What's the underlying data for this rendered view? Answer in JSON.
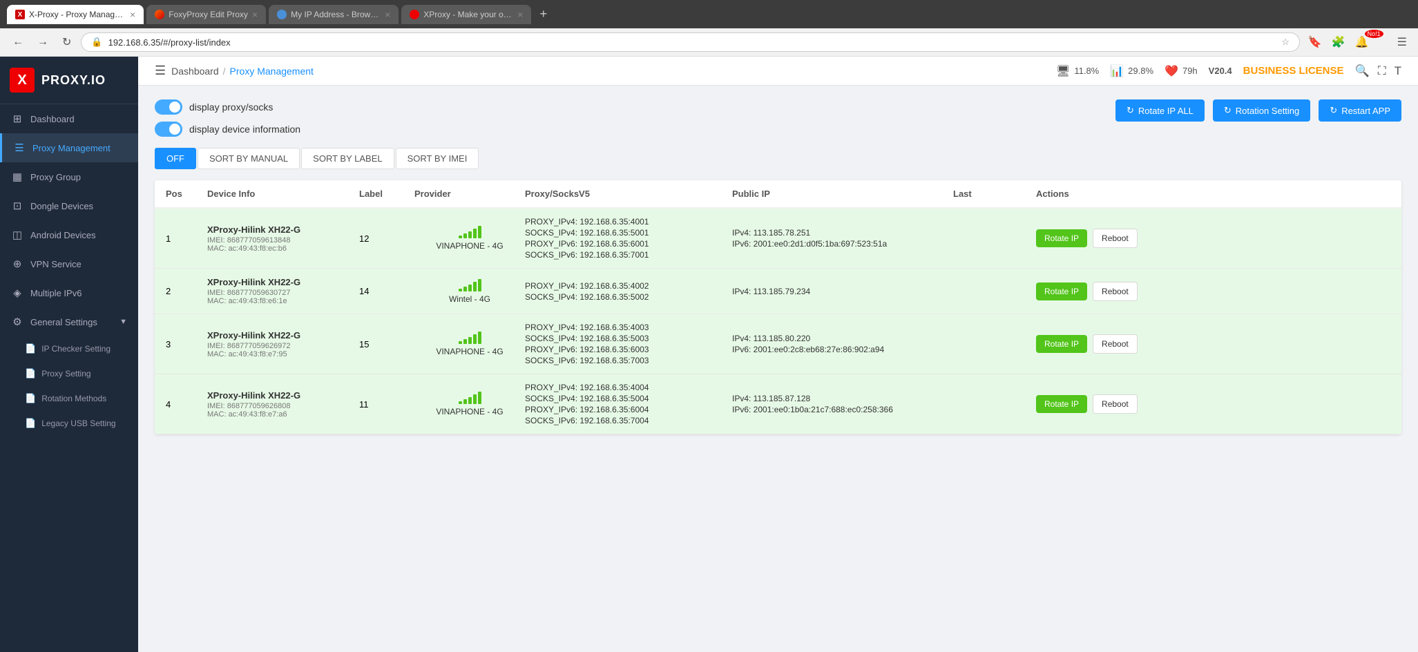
{
  "browser": {
    "tabs": [
      {
        "id": 1,
        "label": "X-Proxy - Proxy Managemen...",
        "favicon_type": "xproxy",
        "active": true
      },
      {
        "id": 2,
        "label": "FoxyProxy Edit Proxy",
        "favicon_type": "fox",
        "active": false
      },
      {
        "id": 3,
        "label": "My IP Address - Browser t...",
        "favicon_type": "browser",
        "active": false
      },
      {
        "id": 4,
        "label": "XProxy - Make your own...",
        "favicon_type": "xproxy-red",
        "active": false
      }
    ],
    "address": "192.168.6.35/#/proxy-list/index"
  },
  "topbar": {
    "breadcrumb_home": "Dashboard",
    "breadcrumb_sep": "/",
    "breadcrumb_current": "Proxy Management",
    "cpu_label": "11.8%",
    "ram_label": "29.8%",
    "uptime_label": "79h",
    "version": "V20.4",
    "license": "BUSINESS LICENSE"
  },
  "toolbar": {
    "toggle1_label": "display proxy/socks",
    "toggle2_label": "display device information",
    "rotate_all_label": "Rotate IP ALL",
    "rotation_setting_label": "Rotation Setting",
    "restart_app_label": "Restart APP"
  },
  "sort_tabs": [
    {
      "id": "off",
      "label": "OFF",
      "active": true
    },
    {
      "id": "manual",
      "label": "SORT BY MANUAL",
      "active": false
    },
    {
      "id": "label",
      "label": "SORT BY LABEL",
      "active": false
    },
    {
      "id": "imei",
      "label": "SORT BY IMEI",
      "active": false
    }
  ],
  "table": {
    "headers": [
      "Pos",
      "Device Info",
      "Label",
      "Provider",
      "Proxy/SocksV5",
      "Public IP",
      "Last",
      "Actions"
    ],
    "rows": [
      {
        "pos": "1",
        "device_name": "XProxy-Hilink XH22-G",
        "imei": "IMEI: 868777059613848",
        "mac": "MAC: ac:49:43:f8:ec:b6",
        "label": "12",
        "provider": "VINAPHONE - 4G",
        "proxy_lines": [
          "PROXY_IPv4: 192.168.6.35:4001",
          "SOCKS_IPv4: 192.168.6.35:5001",
          "PROXY_IPv6: 192.168.6.35:6001",
          "SOCKS_IPv6: 192.168.6.35:7001"
        ],
        "ipv4": "IPv4: 113.185.78.251",
        "ipv6": "IPv6: 2001:ee0:2d1:d0f5:1ba:697:523:51a",
        "rotate_label": "Rotate IP",
        "reboot_label": "Reboot",
        "green": true
      },
      {
        "pos": "2",
        "device_name": "XProxy-Hilink XH22-G",
        "imei": "IMEI: 868777059630727",
        "mac": "MAC: ac:49:43:f8:e6:1e",
        "label": "14",
        "provider": "Wintel - 4G",
        "proxy_lines": [
          "PROXY_IPv4: 192.168.6.35:4002",
          "SOCKS_IPv4: 192.168.6.35:5002"
        ],
        "ipv4": "IPv4: 113.185.79.234",
        "ipv6": "",
        "rotate_label": "Rotate IP",
        "reboot_label": "Reboot",
        "green": true
      },
      {
        "pos": "3",
        "device_name": "XProxy-Hilink XH22-G",
        "imei": "IMEI: 868777059626972",
        "mac": "MAC: ac:49:43:f8:e7:95",
        "label": "15",
        "provider": "VINAPHONE - 4G",
        "proxy_lines": [
          "PROXY_IPv4: 192.168.6.35:4003",
          "SOCKS_IPv4: 192.168.6.35:5003",
          "PROXY_IPv6: 192.168.6.35:6003",
          "SOCKS_IPv6: 192.168.6.35:7003"
        ],
        "ipv4": "IPv4: 113.185.80.220",
        "ipv6": "IPv6: 2001:ee0:2c8:eb68:27e:86:902:a94",
        "rotate_label": "Rotate IP",
        "reboot_label": "Reboot",
        "green": true
      },
      {
        "pos": "4",
        "device_name": "XProxy-Hilink XH22-G",
        "imei": "IMEI: 868777059626808",
        "mac": "MAC: ac:49:43:f8:e7:a6",
        "label": "11",
        "provider": "VINAPHONE - 4G",
        "proxy_lines": [
          "PROXY_IPv4: 192.168.6.35:4004",
          "SOCKS_IPv4: 192.168.6.35:5004",
          "PROXY_IPv6: 192.168.6.35:6004",
          "SOCKS_IPv6: 192.168.6.35:7004"
        ],
        "ipv4": "IPv4: 113.185.87.128",
        "ipv6": "IPv6: 2001:ee0:1b0a:21c7:688:ec0:258:366",
        "rotate_label": "Rotate IP",
        "reboot_label": "Reboot",
        "green": true
      }
    ]
  },
  "sidebar": {
    "logo_text": "PROXY.IO",
    "items": [
      {
        "id": "dashboard",
        "label": "Dashboard",
        "icon": "⊞",
        "active": false
      },
      {
        "id": "proxy-management",
        "label": "Proxy Management",
        "icon": "☰",
        "active": true
      },
      {
        "id": "proxy-group",
        "label": "Proxy Group",
        "icon": "▦",
        "active": false
      },
      {
        "id": "dongle-devices",
        "label": "Dongle Devices",
        "icon": "⊡",
        "active": false
      },
      {
        "id": "android-devices",
        "label": "Android Devices",
        "icon": "◫",
        "active": false
      },
      {
        "id": "vpn-service",
        "label": "VPN Service",
        "icon": "⊕",
        "active": false
      },
      {
        "id": "multiple-ipv6",
        "label": "Multiple IPv6",
        "icon": "◈",
        "active": false
      },
      {
        "id": "general-settings",
        "label": "General Settings",
        "icon": "⚙",
        "active": false,
        "expanded": true
      }
    ],
    "subitems": [
      {
        "id": "ip-checker",
        "label": "IP Checker Setting"
      },
      {
        "id": "proxy-setting",
        "label": "Proxy Setting"
      },
      {
        "id": "rotation-methods",
        "label": "Rotation Methods"
      },
      {
        "id": "legacy-usb",
        "label": "Legacy USB Setting"
      }
    ]
  }
}
